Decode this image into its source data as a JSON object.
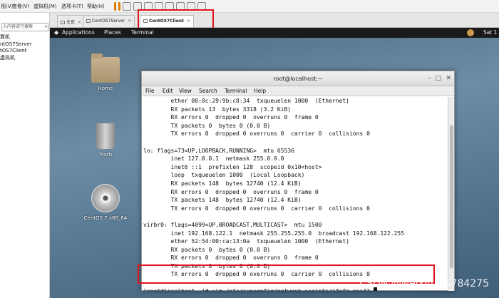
{
  "menu": {
    "items": [
      "视(V)",
      "查看(V)",
      "虚拟机(M)",
      "选项卡(T)",
      "帮助(H)"
    ]
  },
  "sidebar": {
    "search_placeholder": "入内容进行搜索",
    "items": [
      "算机",
      "ntOS7Server",
      "tOS7Client",
      "虚拟机"
    ]
  },
  "tabs": [
    {
      "label": "主页",
      "active": false
    },
    {
      "label": "CentOS7Server",
      "active": false
    },
    {
      "label": "CentOS7Client",
      "active": true
    }
  ],
  "gnome": {
    "applications": "Applications",
    "places": "Places",
    "terminal": "Terminal",
    "clock": "Sat 1"
  },
  "desktop_icons": {
    "home": "Home",
    "trash": "Trash",
    "disc": "CentOS 7 x86_64"
  },
  "terminal": {
    "title": "root@localhost:~",
    "menu": [
      "File",
      "Edit",
      "View",
      "Search",
      "Terminal",
      "Help"
    ],
    "lines": [
      "        ether 00:0c:29:9b:c8:34  txqueuelen 1000  (Ethernet)",
      "        RX packets 13  bytes 3318 (3.2 KiB)",
      "        RX errors 0  dropped 0  overruns 0  frame 0",
      "        TX packets 0  bytes 0 (0.0 B)",
      "        TX errors 0  dropped 0 overruns 0  carrier 0  collisions 0",
      "",
      "lo: flags=73<UP,LOOPBACK,RUNNING>  mtu 65536",
      "        inet 127.0.0.1  netmask 255.0.0.0",
      "        inet6 ::1  prefixlen 128  scopeid 0x10<host>",
      "        loop  txqueuelen 1000  (Local Loopback)",
      "        RX packets 148  bytes 12740 (12.4 KiB)",
      "        RX errors 0  dropped 0  overruns 0  frame 0",
      "        TX packets 148  bytes 12740 (12.4 KiB)",
      "        TX errors 0  dropped 0 overruns 0  carrier 0  collisions 0",
      "",
      "virbr0: flags=4099<UP,BROADCAST,MULTICAST>  mtu 1500",
      "        inet 192.168.122.1  netmask 255.255.255.0  broadcast 192.168.122.255",
      "        ether 52:54:00:ca:13:0a  txqueuelen 1000  (Ethernet)",
      "        RX packets 0  bytes 0 (0.0 B)",
      "        RX errors 0  dropped 0  overruns 0  frame 0",
      "        TX packets 0  bytes 0 (0.0 B)",
      "        TX errors 0  dropped 0 overruns 0  carrier 0  collisions 0",
      ""
    ],
    "prompt": "[root@localhost ~]# vim /etc/sysconfig/network-scripts/ifcfg-ens33 "
  },
  "watermark": "CSDN @weixin_45784275"
}
